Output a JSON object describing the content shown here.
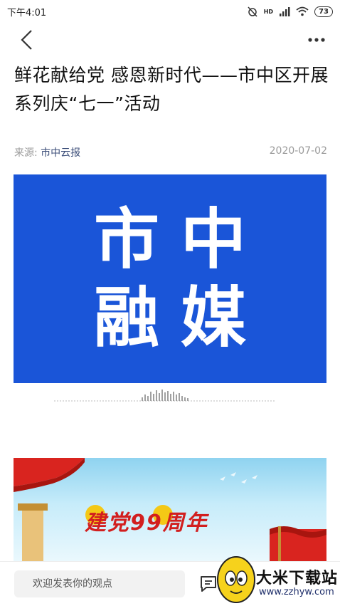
{
  "status_bar": {
    "time": "下午4:01",
    "network": "HD",
    "battery": "73"
  },
  "nav": {
    "back_icon": "chevron-left-icon",
    "more_icon": "more-horizontal-icon"
  },
  "article": {
    "title": "鲜花献给党 感恩新时代——市中区开展系列庆“七一”活动",
    "source_label": "来源: ",
    "source_name": "市中云报",
    "date": "2020-07-02"
  },
  "banner": {
    "line1": "市中",
    "line2": "融媒",
    "background": "#1a55d8"
  },
  "poster": {
    "caption": "建党99周年",
    "accent": "#d21f1f"
  },
  "bottom_bar": {
    "comment_placeholder": "欢迎发表你的观点"
  },
  "watermark": {
    "title": "大米下载站",
    "url": "www.zzhyw.com"
  }
}
